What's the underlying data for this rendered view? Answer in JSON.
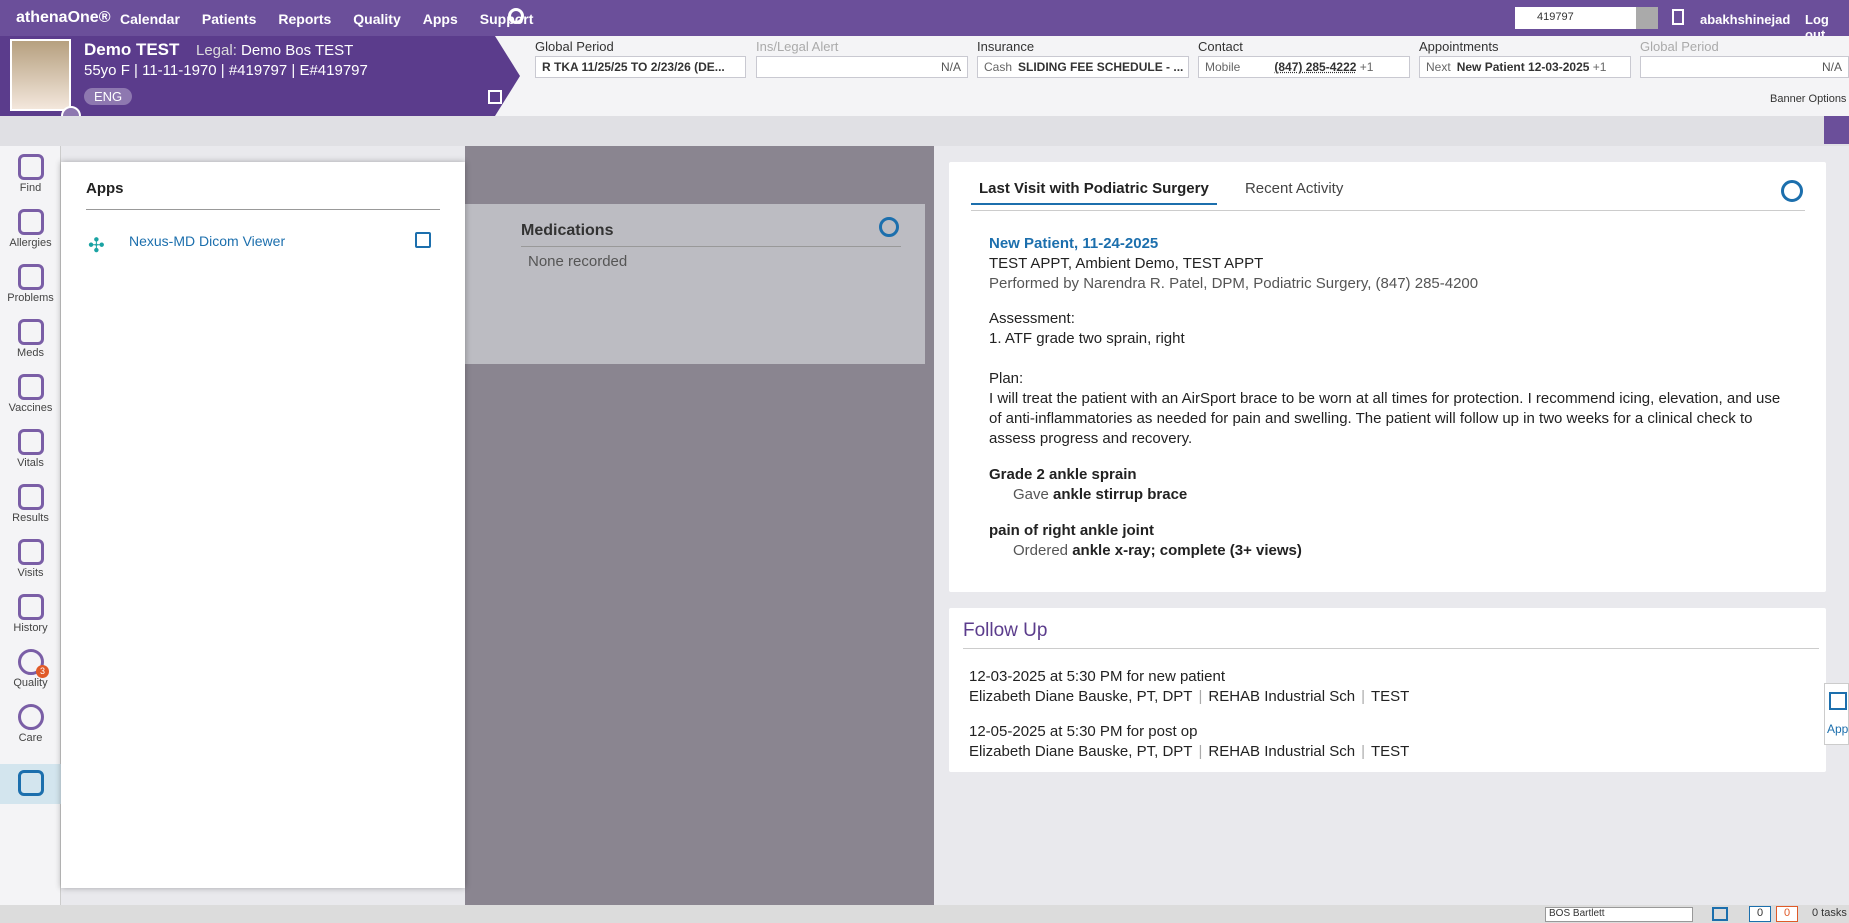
{
  "topnav": {
    "logo": "athenaOne®",
    "items": [
      "Calendar",
      "Patients",
      "Reports",
      "Quality",
      "Apps",
      "Support"
    ],
    "search_value": "419797",
    "username": "abakhshinejad",
    "logout": "Log out"
  },
  "patient": {
    "name": "Demo  TEST",
    "legal_label": "Legal:",
    "legal_name": "Demo Bos TEST",
    "info": "55yo F | 11-11-1970 | #419797 | E#419797",
    "language": "ENG"
  },
  "banner": {
    "global_period": {
      "label": "Global Period",
      "value": "R TKA 11/25/25 TO 2/23/26 (DE..."
    },
    "ins_legal": {
      "label": "Ins/Legal Alert",
      "value": "N/A"
    },
    "insurance": {
      "label": "Insurance",
      "tag": "Cash",
      "value": "SLIDING FEE SCHEDULE - ..."
    },
    "contact": {
      "label": "Contact",
      "tag": "Mobile",
      "value": "(847) 285-4222",
      "extra": "+1"
    },
    "appointments": {
      "label": "Appointments",
      "tag": "Next",
      "value": "New Patient 12-03-2025",
      "extra": "+1"
    },
    "global_period2": {
      "label": "Global Period",
      "value": "N/A"
    },
    "options": "Banner Options"
  },
  "leftbar": [
    "Find",
    "Allergies",
    "Problems",
    "Meds",
    "Vaccines",
    "Vitals",
    "Results",
    "Visits",
    "History",
    "Quality",
    "Care"
  ],
  "quality_badge": "3",
  "apps_panel": {
    "title": "Apps",
    "items": [
      {
        "name": "Nexus-MD Dicom Viewer"
      }
    ]
  },
  "meds": {
    "title": "Medications",
    "value": "None recorded"
  },
  "last_visit": {
    "tabs": [
      "Last Visit with Podiatric Surgery",
      "Recent Activity"
    ],
    "visit_title": "New Patient, 11-24-2025",
    "appt": "TEST APPT, Ambient Demo, TEST APPT",
    "performed": "Performed by Narendra R. Patel, DPM, Podiatric Surgery, (847) 285-4200",
    "assessment_label": "Assessment:",
    "assessment": "1. ATF grade two sprain, right",
    "plan_label": "Plan:",
    "plan": "I will treat the patient with an AirSport brace to be worn at all times for protection. I recommend icing, elevation, and use of anti-inflammatories as needed for pain and swelling. The patient will follow up in two weeks for a clinical check to assess progress and recovery.",
    "dx1": "Grade 2 ankle sprain",
    "dx1_verb": "Gave",
    "dx1_item": "ankle stirrup brace",
    "dx2": "pain of right ankle joint",
    "dx2_verb": "Ordered",
    "dx2_item": "ankle x-ray; complete (3+ views)"
  },
  "follow_up": {
    "title": "Follow Up",
    "items": [
      {
        "when": "12-03-2025 at 5:30 PM for new patient",
        "provider": "Elizabeth Diane Bauske, PT, DPT",
        "dept": "REHAB Industrial Sch",
        "note": "TEST"
      },
      {
        "when": "12-05-2025 at 5:30 PM for post op",
        "provider": "Elizabeth Diane Bauske, PT, DPT",
        "dept": "REHAB Industrial Sch",
        "note": "TEST"
      }
    ]
  },
  "right_apps_label": "App",
  "statusbar": {
    "location": "BOS Bartlett",
    "count1": "0",
    "count2": "0",
    "tasks": "0 tasks"
  }
}
